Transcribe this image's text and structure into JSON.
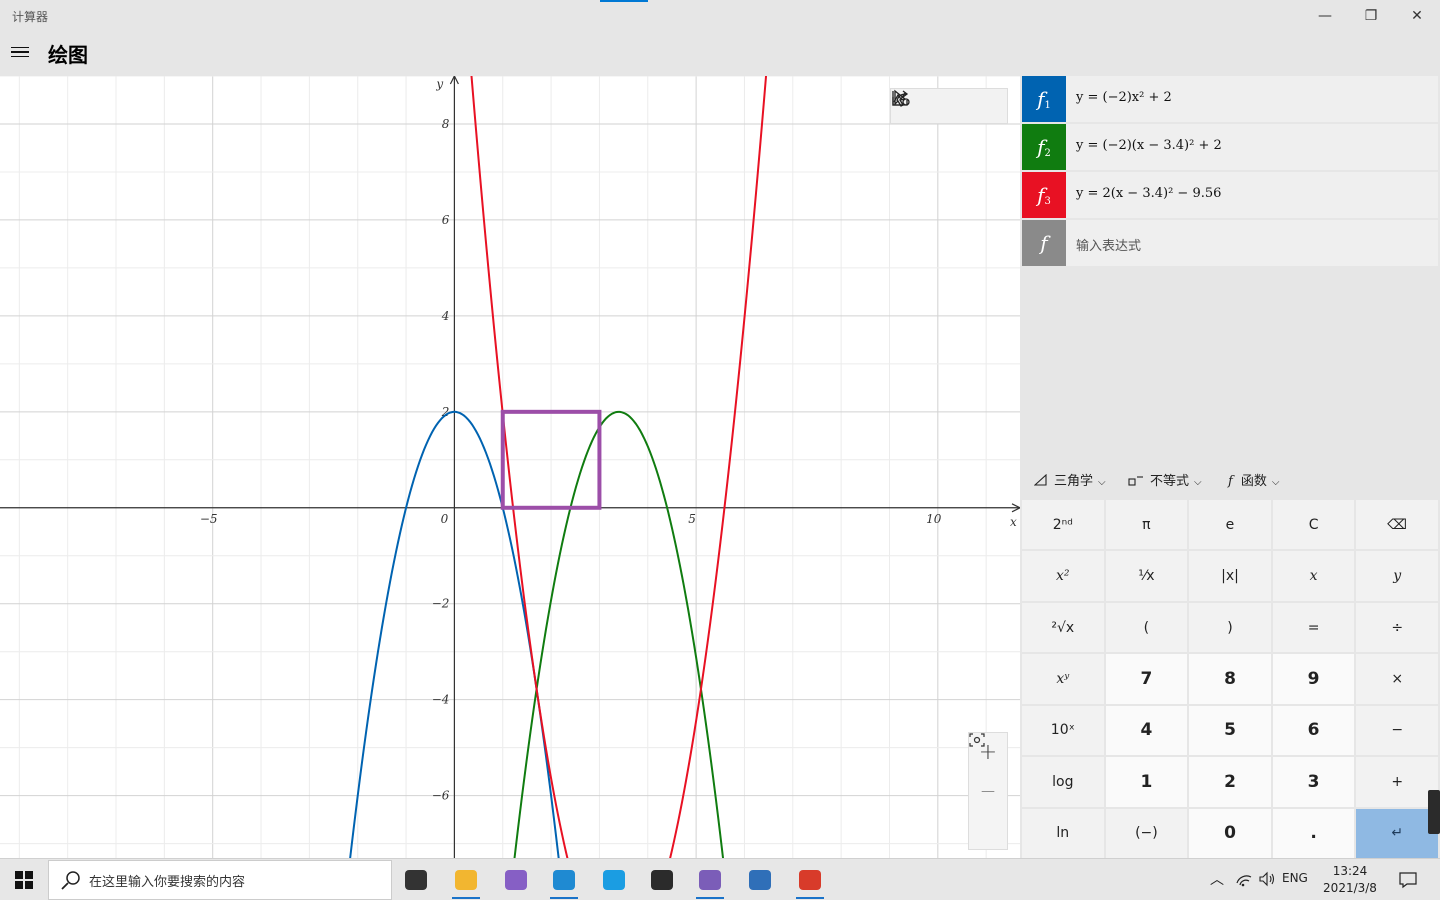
{
  "window": {
    "app_title": "计算器",
    "minimize_glyph": "—",
    "restore_glyph": "❐",
    "close_glyph": "✕"
  },
  "header": {
    "page_title": "绘图"
  },
  "graph": {
    "axis_x_label": "x",
    "axis_y_label": "y",
    "x_tick_labels": [
      {
        "v": -5,
        "text": "−5"
      },
      {
        "v": 0,
        "text": "0"
      },
      {
        "v": 5,
        "text": "5"
      },
      {
        "v": 10,
        "text": "10"
      }
    ],
    "y_tick_labels": [
      {
        "v": 8,
        "text": "8"
      },
      {
        "v": 6,
        "text": "6"
      },
      {
        "v": 4,
        "text": "4"
      },
      {
        "v": 2,
        "text": "2"
      },
      {
        "v": -2,
        "text": "−2"
      },
      {
        "v": -4,
        "text": "−4"
      },
      {
        "v": -6,
        "text": "−6"
      }
    ],
    "x_range": [
      -9.4,
      11.7
    ],
    "y_range": [
      -7.3,
      9.0
    ],
    "functions": [
      {
        "name": "f1",
        "color": "#0063b1",
        "a": -2,
        "h": 0,
        "k": 2
      },
      {
        "name": "f2",
        "color": "#107c10",
        "a": -2,
        "h": 3.4,
        "k": 2
      },
      {
        "name": "f3",
        "color": "#e81123",
        "a": 2,
        "h": 3.4,
        "k": -9.56
      }
    ],
    "highlight_rect": {
      "color": "#9c4ea8",
      "x1": 1,
      "x2": 3,
      "y1": 0,
      "y2": 2
    },
    "toolbar": {
      "trace_icon": "cursor-arrow-icon",
      "share_icon": "share-icon",
      "settings_icon": "graph-settings-icon"
    },
    "zoom": {
      "zoom_in": "+",
      "zoom_out": "—",
      "fit_icon": "fit-view-icon"
    }
  },
  "functions_panel": {
    "items": [
      {
        "letter": "f",
        "sub": "1",
        "color": "#0063b1",
        "expr": "y = (−2)x² + 2"
      },
      {
        "letter": "f",
        "sub": "2",
        "color": "#107c10",
        "expr": "y = (−2)(x − 3.4)² + 2"
      },
      {
        "letter": "f",
        "sub": "3",
        "color": "#e81123",
        "expr": "y = 2(x − 3.4)² − 9.56"
      }
    ],
    "new_entry": {
      "letter": "f",
      "color": "#8a8a8a",
      "placeholder": "输入表达式"
    }
  },
  "keypad": {
    "categories": [
      {
        "label": "三角学",
        "icon": "triangle-icon"
      },
      {
        "label": "不等式",
        "icon": "inequality-icon"
      },
      {
        "label": "函数",
        "icon": "function-icon"
      }
    ],
    "keys": [
      {
        "label": "2ⁿᵈ",
        "kind": "fn"
      },
      {
        "label": "π",
        "kind": "fn"
      },
      {
        "label": "e",
        "kind": "fn"
      },
      {
        "label": "C",
        "kind": "fn"
      },
      {
        "label": "⌫",
        "kind": "fn"
      },
      {
        "label": "x²",
        "kind": "fn",
        "it": true
      },
      {
        "label": "¹⁄x",
        "kind": "fn"
      },
      {
        "label": "|x|",
        "kind": "fn"
      },
      {
        "label": "x",
        "kind": "fn",
        "it": true
      },
      {
        "label": "y",
        "kind": "fn",
        "it": true
      },
      {
        "label": "²√x",
        "kind": "fn"
      },
      {
        "label": "(",
        "kind": "fn"
      },
      {
        "label": ")",
        "kind": "fn"
      },
      {
        "label": "=",
        "kind": "fn"
      },
      {
        "label": "÷",
        "kind": "fn"
      },
      {
        "label": "xʸ",
        "kind": "fn",
        "it": true
      },
      {
        "label": "7",
        "kind": "num"
      },
      {
        "label": "8",
        "kind": "num"
      },
      {
        "label": "9",
        "kind": "num"
      },
      {
        "label": "×",
        "kind": "fn"
      },
      {
        "label": "10ˣ",
        "kind": "fn"
      },
      {
        "label": "4",
        "kind": "num"
      },
      {
        "label": "5",
        "kind": "num"
      },
      {
        "label": "6",
        "kind": "num"
      },
      {
        "label": "−",
        "kind": "fn"
      },
      {
        "label": "log",
        "kind": "fn"
      },
      {
        "label": "1",
        "kind": "num"
      },
      {
        "label": "2",
        "kind": "num"
      },
      {
        "label": "3",
        "kind": "num"
      },
      {
        "label": "+",
        "kind": "fn"
      },
      {
        "label": "ln",
        "kind": "fn"
      },
      {
        "label": "(−)",
        "kind": "fn"
      },
      {
        "label": "0",
        "kind": "num"
      },
      {
        "label": ".",
        "kind": "num"
      },
      {
        "label": "↵",
        "kind": "enter"
      }
    ]
  },
  "taskbar": {
    "search_placeholder": "在这里输入你要搜索的内容",
    "apps": [
      {
        "name": "task-view-icon",
        "color": "#333"
      },
      {
        "name": "file-explorer-icon",
        "color": "#f2b630"
      },
      {
        "name": "visual-studio-icon",
        "color": "#865fc5"
      },
      {
        "name": "vscode-icon",
        "color": "#1f8ad2"
      },
      {
        "name": "edge-icon",
        "color": "#1b9de2"
      },
      {
        "name": "terminal-icon",
        "color": "#2b2b2b"
      },
      {
        "name": "eclipse-icon",
        "color": "#7b5db8"
      },
      {
        "name": "calculator-icon",
        "color": "#2f6fb8"
      },
      {
        "name": "paint-icon",
        "color": "#d83b2a"
      }
    ],
    "lang": "ENG",
    "time": "13:24",
    "date": "2021/3/8"
  }
}
